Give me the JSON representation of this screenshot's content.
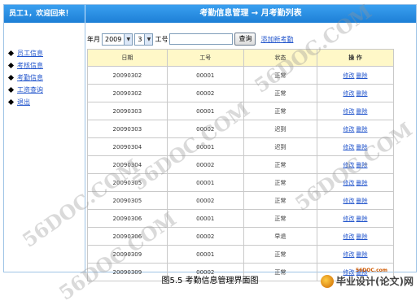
{
  "header": {
    "greeting": "员工1，欢迎回来！",
    "title": "考勤信息管理 → 月考勤列表"
  },
  "sidebar": {
    "items": [
      {
        "label": "员工信息"
      },
      {
        "label": "考核信息"
      },
      {
        "label": "考勤信息"
      },
      {
        "label": "工资查询"
      },
      {
        "label": "退出"
      }
    ]
  },
  "filter": {
    "year_month_label": "年月",
    "year_value": "2009",
    "month_value": "3",
    "employee_no_label": "工号",
    "search_label": "查询",
    "add_label": "添加新考勤"
  },
  "table": {
    "columns": [
      "日期",
      "工号",
      "状态",
      "操 作"
    ],
    "edit_label": "修改",
    "delete_label": "删除",
    "rows": [
      [
        "20090302",
        "00001",
        "正常"
      ],
      [
        "20090302",
        "00002",
        "正常"
      ],
      [
        "20090303",
        "00001",
        "正常"
      ],
      [
        "20090303",
        "00002",
        "迟到"
      ],
      [
        "20090304",
        "00001",
        "迟到"
      ],
      [
        "20090304",
        "00002",
        "正常"
      ],
      [
        "20090305",
        "00001",
        "正常"
      ],
      [
        "20090305",
        "00002",
        "正常"
      ],
      [
        "20090306",
        "00001",
        "正常"
      ],
      [
        "20090306",
        "00002",
        "早退"
      ],
      [
        "20090309",
        "00001",
        "正常"
      ],
      [
        "20090309",
        "00002",
        "正常"
      ]
    ]
  },
  "caption": "图5.5  考勤信息管理界面图",
  "logo": {
    "site": "56DOC.com",
    "text": "毕业设计(论文)网"
  },
  "watermark": "56DOC.COM"
}
